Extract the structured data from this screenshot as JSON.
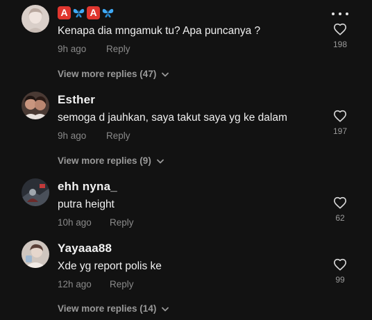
{
  "comments": [
    {
      "username": "",
      "name_emoji": [
        "A",
        "butterfly",
        "A",
        "butterfly"
      ],
      "text": "Kenapa dia mngamuk tu? Apa puncanya ?",
      "time": "9h ago",
      "reply_label": "Reply",
      "likes": "198",
      "view_replies": "View more replies (47)"
    },
    {
      "username": "Esther",
      "text": "semoga d jauhkan, saya takut saya yg ke dalam",
      "time": "9h ago",
      "reply_label": "Reply",
      "likes": "197",
      "view_replies": "View more replies (9)"
    },
    {
      "username": "ehh nyna_",
      "text": "putra height",
      "time": "10h ago",
      "reply_label": "Reply",
      "likes": "62"
    },
    {
      "username": "Yayaaa88",
      "text": "Xde yg report polis ke",
      "time": "12h ago",
      "reply_label": "Reply",
      "likes": "99",
      "view_replies": "View more replies (14)"
    }
  ],
  "icons": {
    "more": "more-options-icon",
    "like": "heart-outline-icon",
    "expand": "chevron-down-icon",
    "name_emoji": [
      "a-button-emoji",
      "butterfly-emoji"
    ]
  },
  "colors": {
    "background": "#121212",
    "primary_text": "#f0f0f0",
    "secondary_text": "#8a8a8a",
    "emoji_red": "#e0362f",
    "butterfly_blue": "#3fa9f5"
  }
}
